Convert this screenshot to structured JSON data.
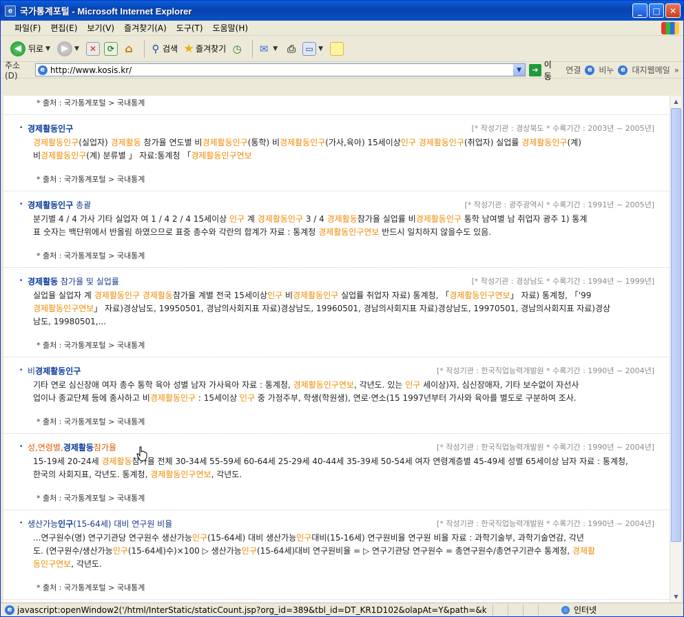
{
  "window": {
    "title": "국가통계포털 - Microsoft Internet Explorer",
    "menu": [
      "파일(F)",
      "편집(E)",
      "보기(V)",
      "즐겨찾기(A)",
      "도구(T)",
      "도움말(H)"
    ],
    "toolbar": {
      "back": "뒤로",
      "search": "검색",
      "favorites": "즐겨찾기"
    },
    "address": {
      "label": "주소(D)",
      "url": "http://www.kosis.kr/",
      "go": "이동"
    },
    "links": {
      "label": "연결",
      "items": [
        "비누",
        "대지웹메일"
      ],
      "more": "»"
    },
    "status": {
      "text": "javascript:openWindow2('/html/InterStatic/staticCount.jsp?org_id=389&tbl_id=DT_KR1D102&olapAt=Y&path=&k",
      "zone": "인터넷"
    }
  },
  "first_source": "* 출처 : 국가통계포털 > 국내통계",
  "results": [
    {
      "title_parts": [
        {
          "t": "경제활동인구",
          "c": "kw"
        }
      ],
      "meta": "[* 작성기관 : 경상북도   * 수록기간 : 2003년 ~ 2005년]",
      "body_lines": [
        [
          {
            "t": "경제활동인구",
            "c": "hl"
          },
          {
            "t": "(실업자) "
          },
          {
            "t": "경제활동",
            "c": "hl"
          },
          {
            "t": " 참가율 연도별 비"
          },
          {
            "t": "경제활동인구",
            "c": "hl"
          },
          {
            "t": "(통학) 비"
          },
          {
            "t": "경제활동인구",
            "c": "hl"
          },
          {
            "t": "(가사,육아) 15세이상"
          },
          {
            "t": "인구",
            "c": "hl"
          },
          {
            "t": " "
          },
          {
            "t": "경제활동인구",
            "c": "hl"
          },
          {
            "t": "(취업자) 실업률 "
          },
          {
            "t": "경제활동인구",
            "c": "hl"
          },
          {
            "t": "(계)"
          }
        ],
        [
          {
            "t": "비"
          },
          {
            "t": "경제활동인구",
            "c": "hl"
          },
          {
            "t": "(계) 분류별 」 자료:통계청 「"
          },
          {
            "t": "경제활동인구연보",
            "c": "hl"
          }
        ]
      ],
      "source": "* 출처 : 국가통계포털 > 국내통계"
    },
    {
      "title_parts": [
        {
          "t": "경제활동인구",
          "c": "kw"
        },
        {
          "t": " 총괄"
        }
      ],
      "meta": "[* 작성기관 : 광주광역시   * 수록기간 : 1991년 ~ 2005년]",
      "body_lines": [
        [
          {
            "t": "분기별 4 / 4 가사 기타 실업자 여 1 / 4 2 / 4 15세이상 "
          },
          {
            "t": "인구",
            "c": "hl"
          },
          {
            "t": " 계 "
          },
          {
            "t": "경제활동인구",
            "c": "hl"
          },
          {
            "t": " 3 / 4 "
          },
          {
            "t": "경제활동",
            "c": "hl"
          },
          {
            "t": "참가율 실업률 비"
          },
          {
            "t": "경제활동인구",
            "c": "hl"
          },
          {
            "t": " 통학 남여별 남 취업자 광주 1) 통계"
          }
        ],
        [
          {
            "t": "표 숫자는 백단위에서 반올림 하였으므로 표중 총수와 각란의 합계가 자료 : 통계청 "
          },
          {
            "t": "경제활동인구연보",
            "c": "hl"
          },
          {
            "t": " 반드시 일치하지 않을수도 있음."
          }
        ]
      ],
      "source": "* 출처 : 국가통계포털 > 국내통계"
    },
    {
      "title_parts": [
        {
          "t": "경제활동",
          "c": "kw"
        },
        {
          "t": " 참가율 및 실업률"
        }
      ],
      "meta": "[* 작성기관 : 경상남도   * 수록기간 : 1994년 ~ 1999년]",
      "body_lines": [
        [
          {
            "t": "실업율 실업자 계 "
          },
          {
            "t": "경제활동인구 경제활동",
            "c": "hl"
          },
          {
            "t": "참가율 계별 전국 15세이상"
          },
          {
            "t": "인구",
            "c": "hl"
          },
          {
            "t": " 비"
          },
          {
            "t": "경제활동인구",
            "c": "hl"
          },
          {
            "t": " 실업률 취업자 자료) 통계청, 「"
          },
          {
            "t": "경제활동인구연보",
            "c": "hl"
          },
          {
            "t": "」 자료) 통계청, 「'99"
          }
        ],
        [
          {
            "t": "경제활동인구연보",
            "c": "hl"
          },
          {
            "t": "」 자료)경상남도, 19950501, 경남의사회지표 자료)경상남도, 19960501, 경남의사회지표 자료)경상남도, 19970501, 경남의사회지표 자료)경상"
          }
        ],
        [
          {
            "t": "남도, 19980501,..."
          }
        ]
      ],
      "source": "* 출처 : 국가통계포털 > 국내통계"
    },
    {
      "title_parts": [
        {
          "t": "비"
        },
        {
          "t": "경제활동인구",
          "c": "kw"
        }
      ],
      "meta": "[* 작성기관 : 한국직업능력개발원   * 수록기간 : 1990년 ~ 2004년]",
      "body_lines": [
        [
          {
            "t": "기타 연로 심신장애 여자 총수 통학 육아 성별 남자 가사육아 자료 : 통계청, "
          },
          {
            "t": "경제활동인구연보",
            "c": "hl"
          },
          {
            "t": ", 각년도. 있는 "
          },
          {
            "t": "인구",
            "c": "hl"
          },
          {
            "t": " 세이상)자, 심신장애자, 기타 보수없이 자선사"
          }
        ],
        [
          {
            "t": "업이나 종교단체 등에 종사하고 비"
          },
          {
            "t": "경제활동인구",
            "c": "hl"
          },
          {
            "t": " : 15세이상 "
          },
          {
            "t": "인구",
            "c": "hl"
          },
          {
            "t": " 중 가정주부, 학생(학원생), 연로·연소(15 1997년부터 가사와 육아를 별도로 구분하여 조사."
          }
        ]
      ],
      "source": "* 출처 : 국가통계포털 > 국내통계"
    },
    {
      "title_parts": [
        {
          "t": "성,연령별,",
          "c": "or"
        },
        {
          "t": "경제활동",
          "c": "kw"
        },
        {
          "t": "참가율",
          "c": "or"
        }
      ],
      "meta": "[* 작성기관 : 한국직업능력개발원   * 수록기간 : 1990년 ~ 2004년]",
      "body_lines": [
        [
          {
            "t": "15-19세 20-24세 "
          },
          {
            "t": "경제활동",
            "c": "hl"
          },
          {
            "t": "참가율 전체 30-34세 55-59세 60-64세 25-29세 40-44세 35-39세 50-54세 여자 연령계층별 45-49세 성별 65세이상 남자 자료 : 통계청,"
          }
        ],
        [
          {
            "t": "한국의 사회지표, 각년도. 통계청, "
          },
          {
            "t": "경제활동인구연보",
            "c": "hl"
          },
          {
            "t": ", 각년도."
          }
        ]
      ],
      "source": "* 출처 : 국가통계포털 > 국내통계"
    },
    {
      "title_parts": [
        {
          "t": "생산가능"
        },
        {
          "t": "인구",
          "c": "kw"
        },
        {
          "t": "(15-64세) 대비 연구원 비율"
        }
      ],
      "meta": "[* 작성기관 : 한국직업능력개발원   * 수록기간 : 1990년 ~ 2004년]",
      "body_lines": [
        [
          {
            "t": "...연구원수(명) 연구기관당 연구원수 생산가능"
          },
          {
            "t": "인구",
            "c": "hl"
          },
          {
            "t": "(15-64세) 대비 생산가능"
          },
          {
            "t": "인구",
            "c": "hl"
          },
          {
            "t": "대비(15-16세) 연구원비율 연구원 비율 자료 : 과학기술부, 과학기술연감, 각년"
          }
        ],
        [
          {
            "t": "도. (연구원수/생산가능"
          },
          {
            "t": "인구",
            "c": "hl"
          },
          {
            "t": "(15-64세)수)×100 ▷ 생산가능"
          },
          {
            "t": "인구",
            "c": "hl"
          },
          {
            "t": "(15-64세)대비 연구원비율 = ▷ 연구기관당 연구원수 = 총연구원수/총연구기관수 통계청, "
          },
          {
            "t": "경제활",
            "c": "hl"
          }
        ],
        [
          {
            "t": "동인구연보",
            "c": "hl"
          },
          {
            "t": ", 각년도."
          }
        ]
      ],
      "source": "* 출처 : 국가통계포털 > 국내통계"
    }
  ]
}
